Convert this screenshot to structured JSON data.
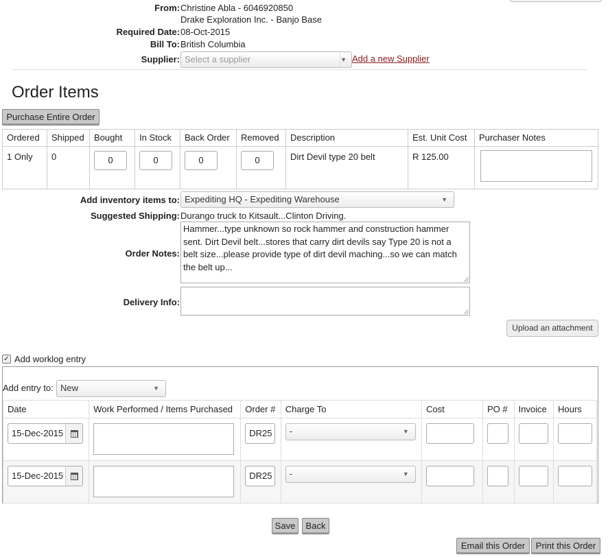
{
  "header": {
    "from_label": "From:",
    "from_name": "Christine Abla - 6046920850",
    "from_company": "Drake Exploration Inc. - Banjo Base",
    "required_label": "Required Date:",
    "required_value": "08-Oct-2015",
    "billto_label": "Bill To:",
    "billto_value": "British Columbia",
    "supplier_label": "Supplier:",
    "supplier_placeholder": "Select a supplier",
    "add_supplier_link": "Add a new Supplier"
  },
  "order_items": {
    "title": "Order Items",
    "purchase_button": "Purchase Entire Order",
    "columns": [
      "Ordered",
      "Shipped",
      "Bought",
      "In Stock",
      "Back Order",
      "Removed",
      "Description",
      "Est. Unit Cost",
      "Purchaser Notes"
    ],
    "rows": [
      {
        "ordered": "1 Only",
        "shipped": "0",
        "bought": "0",
        "in_stock": "0",
        "back_order": "0",
        "removed": "0",
        "description": "Dirt Devil type 20 belt",
        "unit_cost": "R 125.00",
        "notes": ""
      }
    ]
  },
  "details": {
    "inventory_label": "Add inventory items to:",
    "inventory_value": "Expediting HQ - Expediting Warehouse",
    "shipping_label": "Suggested Shipping:",
    "shipping_value": "Durango truck to Kitsault...Clinton Driving.",
    "notes_label": "Order Notes:",
    "notes_value": "Hammer...type unknown so rock hammer and construction hammer sent. Dirt Devil belt...stores that carry dirt devils say Type 20 is not a belt size...please provide type of dirt devil maching...so we can match the belt up...",
    "delivery_label": "Delivery Info:",
    "delivery_value": "",
    "upload_button": "Upload an attachment"
  },
  "worklog": {
    "checkbox_label": "Add worklog entry",
    "entry_label": "Add entry to:",
    "entry_value": "New",
    "columns": [
      "Date",
      "Work Performed / Items Purchased",
      "Order #",
      "Charge To",
      "Cost",
      "PO #",
      "Invoice",
      "Hours"
    ],
    "rows": [
      {
        "date": "15-Dec-2015",
        "work": "",
        "order": "DR25",
        "charge": "-",
        "cost": "",
        "po": "",
        "invoice": "",
        "hours": ""
      },
      {
        "date": "15-Dec-2015",
        "work": "",
        "order": "DR25",
        "charge": "-",
        "cost": "",
        "po": "",
        "invoice": "",
        "hours": ""
      }
    ]
  },
  "actions": {
    "save": "Save",
    "back": "Back",
    "email": "Email this Order",
    "print": "Print this Order"
  }
}
